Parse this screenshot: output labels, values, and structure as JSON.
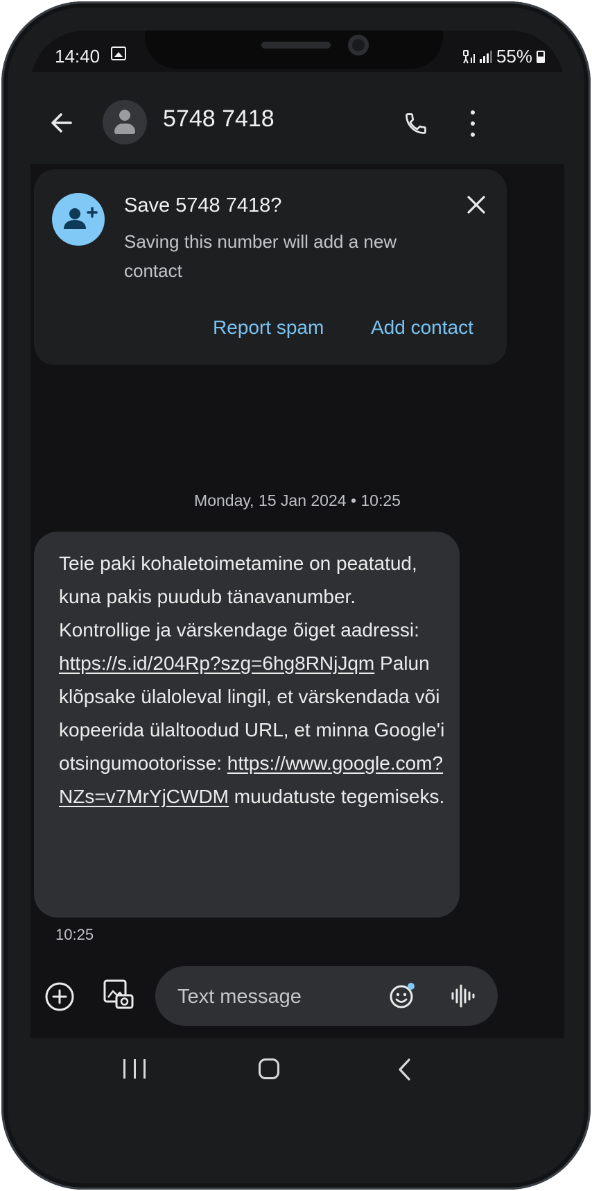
{
  "status_bar": {
    "time": "14:40",
    "battery": "55%",
    "battery_level": 0.55
  },
  "header": {
    "title": "5748 7418"
  },
  "save_card": {
    "title": "Save 5748 7418?",
    "description": "Saving this number will add a new contact",
    "report_spam_label": "Report spam",
    "add_contact_label": "Add contact"
  },
  "conversation": {
    "date_separator": "Monday, 15 Jan 2024 • 10:25",
    "message": {
      "part1": "Teie paki kohaletoimetamine on peatatud, kuna pakis puudub tänavanumber. Kontrollige ja värskendage õiget aadressi: ",
      "link1": "https://s.id/204Rp?szg=6hg8RNjJqm",
      "part2": " Palun klõpsake ülaloleval lingil, et värskendada või kopeerida ülaltoodud URL, et minna Google'i otsingumootorisse: ",
      "link2": "https://www.google.com?NZs=v7MrYjCWDM",
      "part3": " muudatuste tegemiseks.",
      "time": "10:25"
    }
  },
  "compose": {
    "placeholder": "Text message"
  },
  "colors": {
    "accent": "#79c3f2",
    "badge": "#80c8f5",
    "bubble": "#2e3033",
    "background": "#121214"
  }
}
